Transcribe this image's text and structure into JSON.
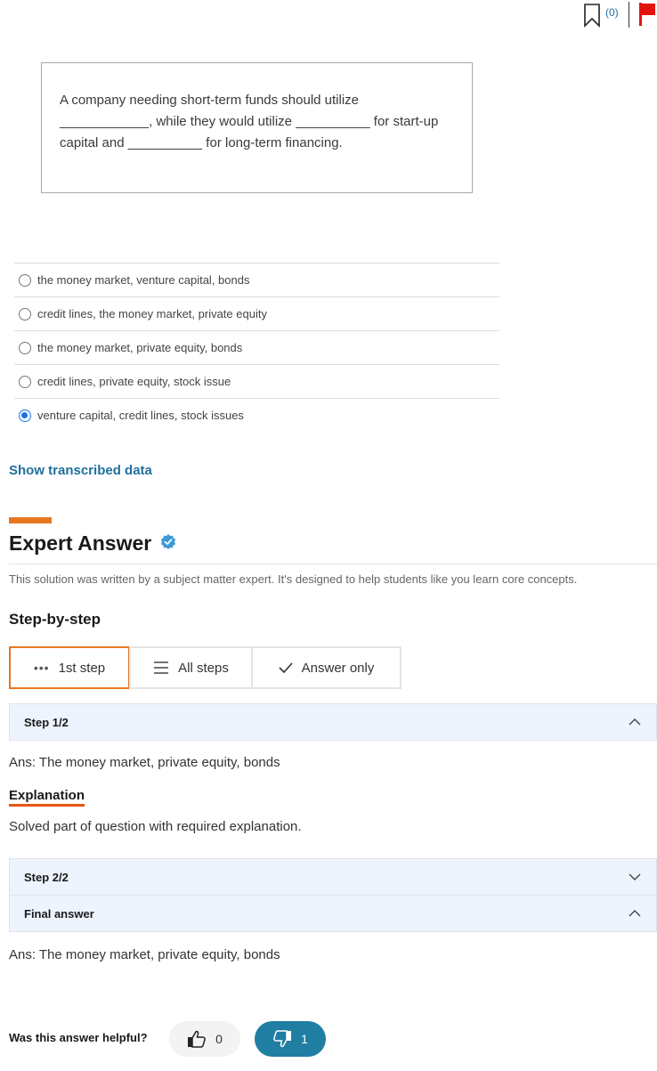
{
  "header": {
    "bookmark_count": "(0)",
    "icons": {
      "bookmark": "bookmark-icon",
      "flag": "flag-icon"
    },
    "flag_color": "#e3140f"
  },
  "question": {
    "text": "A company needing short-term funds should utilize\n____________, while they would utilize __________ for start-up\ncapital and __________ for long-term financing."
  },
  "options": [
    {
      "label": "the money market, venture capital, bonds",
      "selected": false
    },
    {
      "label": "credit lines, the money market, private equity",
      "selected": false
    },
    {
      "label": "the money market, private equity, bonds",
      "selected": false
    },
    {
      "label": "credit lines, private equity, stock issue",
      "selected": false
    },
    {
      "label": "venture capital, credit lines, stock issues",
      "selected": true
    }
  ],
  "show_transcribed_label": "Show transcribed data",
  "expert": {
    "title": "Expert Answer",
    "description": "This solution was written by a subject matter expert. It's designed to help students like you learn core concepts.",
    "step_by_step_label": "Step-by-step",
    "accent_color": "#e87722",
    "tabs": [
      {
        "label": "1st step",
        "icon": "more-dots-icon",
        "active": true
      },
      {
        "label": "All steps",
        "icon": "menu-lines-icon",
        "active": false
      },
      {
        "label": "Answer only",
        "icon": "check-icon",
        "active": false
      }
    ],
    "steps": [
      {
        "title": "Step 1/2",
        "expanded": true,
        "answer": "Ans:  The money market, private equity, bonds",
        "explanation_heading": "Explanation",
        "explanation_text": "Solved part of question with required explanation."
      },
      {
        "title": "Step 2/2",
        "expanded": false
      }
    ],
    "final": {
      "title": "Final answer",
      "expanded": true,
      "answer": "Ans:  The money market, private equity, bonds"
    }
  },
  "feedback": {
    "question": "Was this answer helpful?",
    "thumbs_up_count": "0",
    "thumbs_down_count": "1",
    "down_active_color": "#1f7ea1"
  }
}
